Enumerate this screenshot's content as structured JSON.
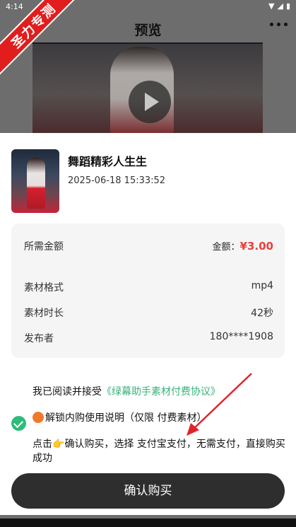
{
  "status_bar": {
    "time": "4:14"
  },
  "header": {
    "title": "预览"
  },
  "watermark": {
    "text": "圣力专测"
  },
  "item": {
    "title": "舞蹈精彩人生生",
    "date": "2025-06-18 15:33:52"
  },
  "info": {
    "amount_label": "所需金额",
    "price_label": "金额：",
    "price_value": "¥3.00",
    "format_label": "素材格式",
    "format_value": "mp4",
    "duration_label": "素材时长",
    "duration_value": "42秒",
    "publisher_label": "发布者",
    "publisher_value": "180****1908"
  },
  "agreement": {
    "prefix": "我已阅读并接受",
    "link": "《绿幕助手素材付费协议》"
  },
  "notice": {
    "text": "解锁内购使用说明（仅限 付费素材）"
  },
  "instruction": {
    "prefix": "点击",
    "text": "确认购买，选择 支付宝支付，无需支付，直接购买成功"
  },
  "confirm_button": {
    "label": "确认购买"
  },
  "colors": {
    "accent_green": "#37b37b",
    "price_red": "#e8413c",
    "button_dark": "#2e2e2e"
  }
}
